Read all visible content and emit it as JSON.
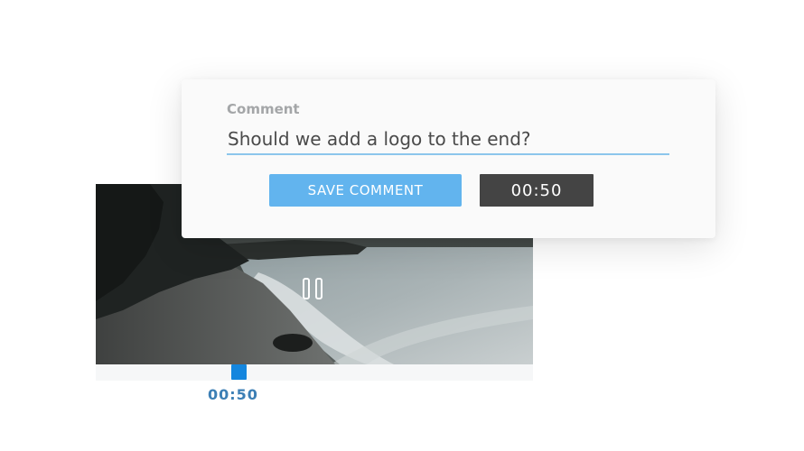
{
  "comment_card": {
    "label": "Comment",
    "comment_text": "Should we add a logo to the end?",
    "save_label": "SAVE COMMENT",
    "timestamp": "00:50"
  },
  "player": {
    "current_time": "00:50",
    "playback_state": "playing",
    "controls_icon": "pause-icon"
  },
  "colors": {
    "accent": "#62b4ee",
    "scrubber": "#1486de",
    "time_text": "#3c7fb5",
    "timestamp_button": "#444444",
    "input_underline": "#8cc6ec"
  }
}
